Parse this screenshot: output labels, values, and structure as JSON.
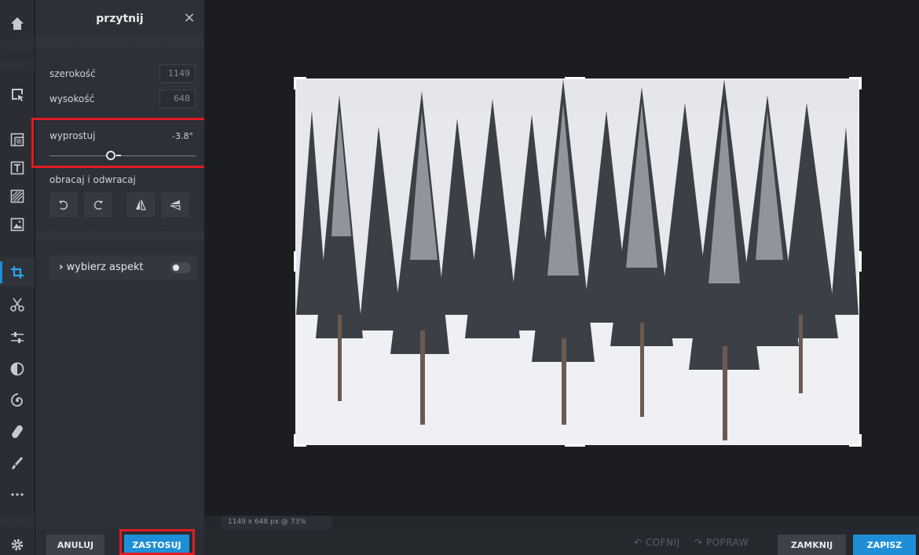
{
  "panel": {
    "title": "przytnij",
    "close": "×",
    "width_label": "szerokość",
    "width_value": "1149",
    "height_label": "wysokość",
    "height_value": "648",
    "straighten_label": "wyprostuj",
    "straighten_value": "-3.8°",
    "straighten_level_fraction": 0.45,
    "rotate_label": "obracaj i odwracaj",
    "aspect_label": "wybierz aspekt",
    "aspect_toggle_on": false,
    "aspect_chevron": "›"
  },
  "footer": {
    "cancel_label": "ANULUJ",
    "apply_label": "ZASTOSUJ"
  },
  "status": {
    "info": "1149 x 648 px @ 73%"
  },
  "bottom": {
    "undo_label": "COFNIJ",
    "redo_label": "POPRAW",
    "close_label": "ZAMKNIJ",
    "save_label": "ZAPISZ"
  },
  "toolbar": {
    "active_tool": "crop-tool",
    "tools": [
      "home-icon",
      "select-icon",
      "layout-icon",
      "text-icon",
      "pattern-icon",
      "image-icon",
      "crop-icon",
      "cut-icon",
      "adjust-icon",
      "contrast-icon",
      "spiral-icon",
      "bandage-icon",
      "brush-icon",
      "more-icon",
      "settings-icon"
    ]
  },
  "colors": {
    "accent": "#1e8fd6",
    "highlight": "#e11b22"
  }
}
